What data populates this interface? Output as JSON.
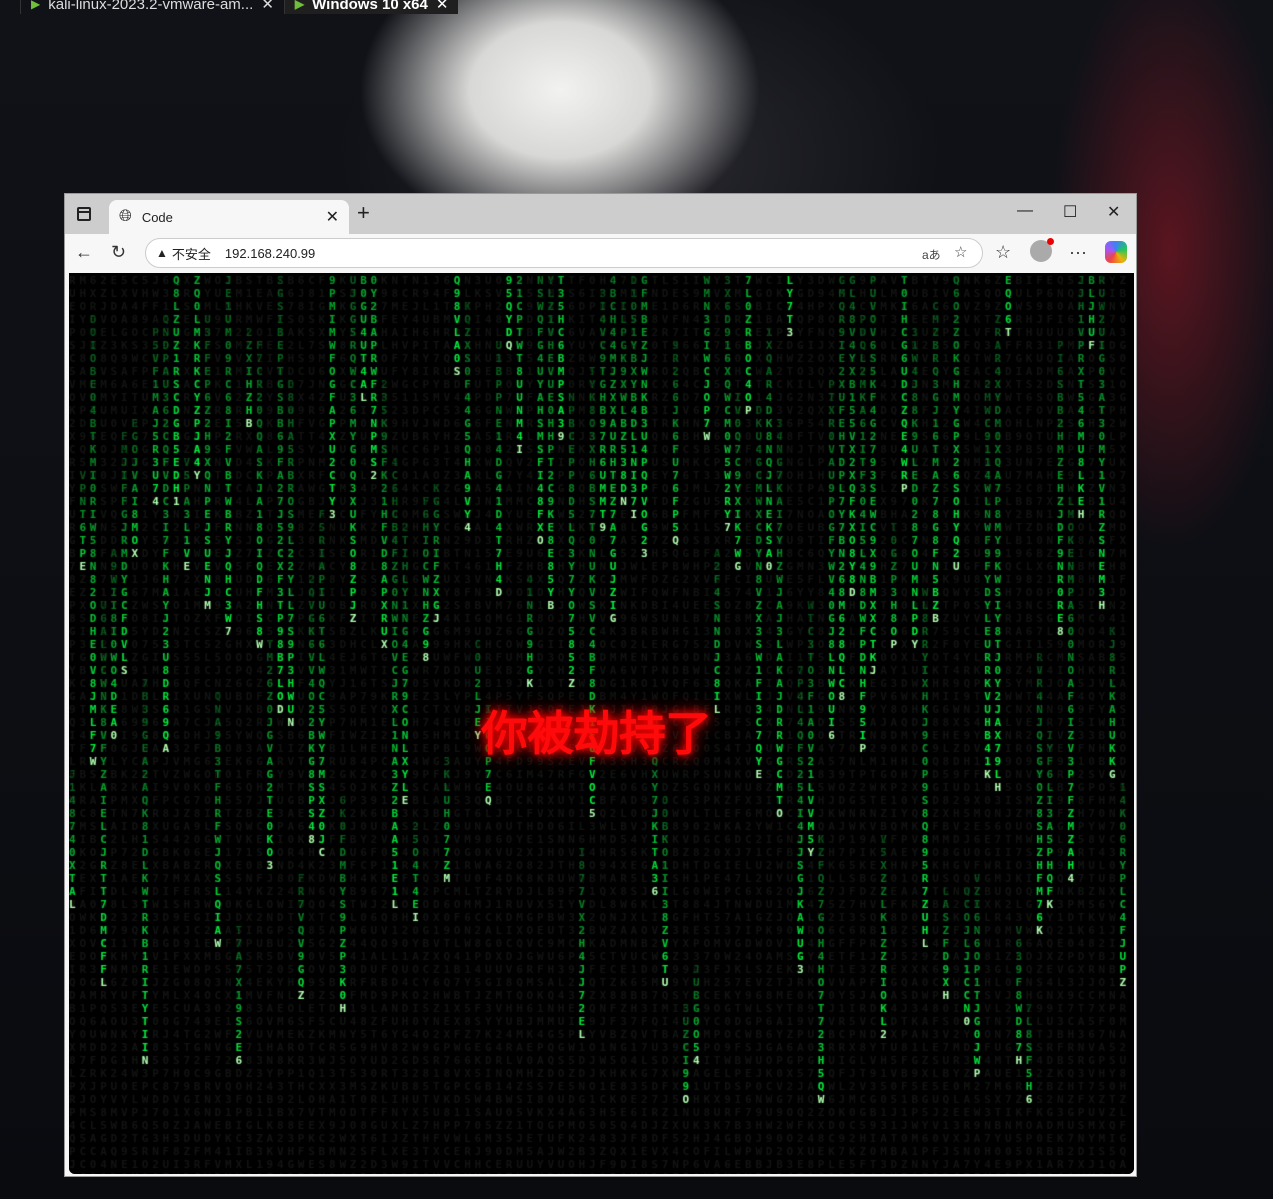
{
  "host_tabs": [
    {
      "label": "kali-linux-2023.2-vmware-am...",
      "active": false
    },
    {
      "label": "Windows 10 x64",
      "active": true
    }
  ],
  "browser": {
    "tab_title": "Code",
    "security_label": "不安全",
    "url": "192.168.240.99",
    "read_aloud_label": "aあ"
  },
  "page": {
    "message": "你被劫持了",
    "message_color": "#ff0a0a",
    "rain_color": "#00ff41",
    "rain_charset": "ABCDEFGHIJKLMNOPQRSTUVWXYZ0123456789"
  }
}
